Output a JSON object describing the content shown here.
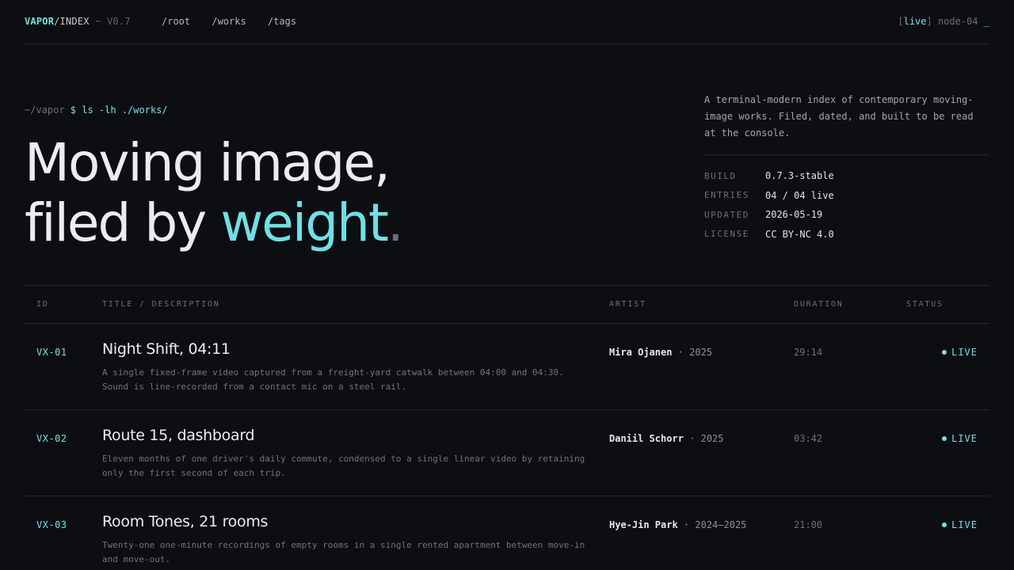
{
  "brand": {
    "name_a": "VAPOR",
    "name_b": "/INDEX",
    "version": " ~ V0.7"
  },
  "nav": {
    "items": [
      "/root",
      "/works",
      "/tags"
    ]
  },
  "top_status": {
    "open_bracket": "[",
    "live": "live",
    "close_bracket": "]",
    "node": " node-04 ",
    "cursor": "_"
  },
  "prompt": {
    "path": "~/vapor ",
    "dollar": "$",
    "command": " ls -lh ./works/"
  },
  "headline": {
    "line1": "Moving image,",
    "line2_a": "filed by ",
    "line2_accent": "weight",
    "line2_dot": "."
  },
  "side": {
    "description": "A terminal-modern index of contemporary moving-image works. Filed, dated, and built to be read at the console.",
    "meta": [
      {
        "key": "BUILD",
        "value": "0.7.3-stable"
      },
      {
        "key": "ENTRIES",
        "value": "04 / 04 live"
      },
      {
        "key": "UPDATED",
        "value": "2026-05-19"
      },
      {
        "key": "LICENSE",
        "value": "CC BY-NC 4.0"
      }
    ]
  },
  "table": {
    "headers": {
      "id": "ID",
      "title": "TITLE / DESCRIPTION",
      "artist": "ARTIST",
      "duration": "DURATION",
      "status": "STATUS"
    },
    "rows": [
      {
        "id": "VX-01",
        "title": "Night Shift, 04:11",
        "description": "A single fixed-frame video captured from a freight-yard catwalk between 04:00 and 04:30. Sound is line-recorded from a contact mic on a steel rail.",
        "artist": "Mira Ojanen",
        "year": " · 2025",
        "duration": "29:14",
        "status": "LIVE"
      },
      {
        "id": "VX-02",
        "title": "Route 15, dashboard",
        "description": "Eleven months of one driver's daily commute, condensed to a single linear video by retaining only the first second of each trip.",
        "artist": "Daniil Schorr",
        "year": " · 2025",
        "duration": "03:42",
        "status": "LIVE"
      },
      {
        "id": "VX-03",
        "title": "Room Tones, 21 rooms",
        "description": "Twenty-one one-minute recordings of empty rooms in a single rented apartment between move-in and move-out.",
        "artist": "Hye-Jin Park",
        "year": " · 2024–2025",
        "duration": "21:00",
        "status": "LIVE"
      }
    ]
  },
  "colors": {
    "accent": "#6ee0e6",
    "background": "#0d0e11",
    "text": "#ececf0",
    "muted": "#6b6f77"
  }
}
